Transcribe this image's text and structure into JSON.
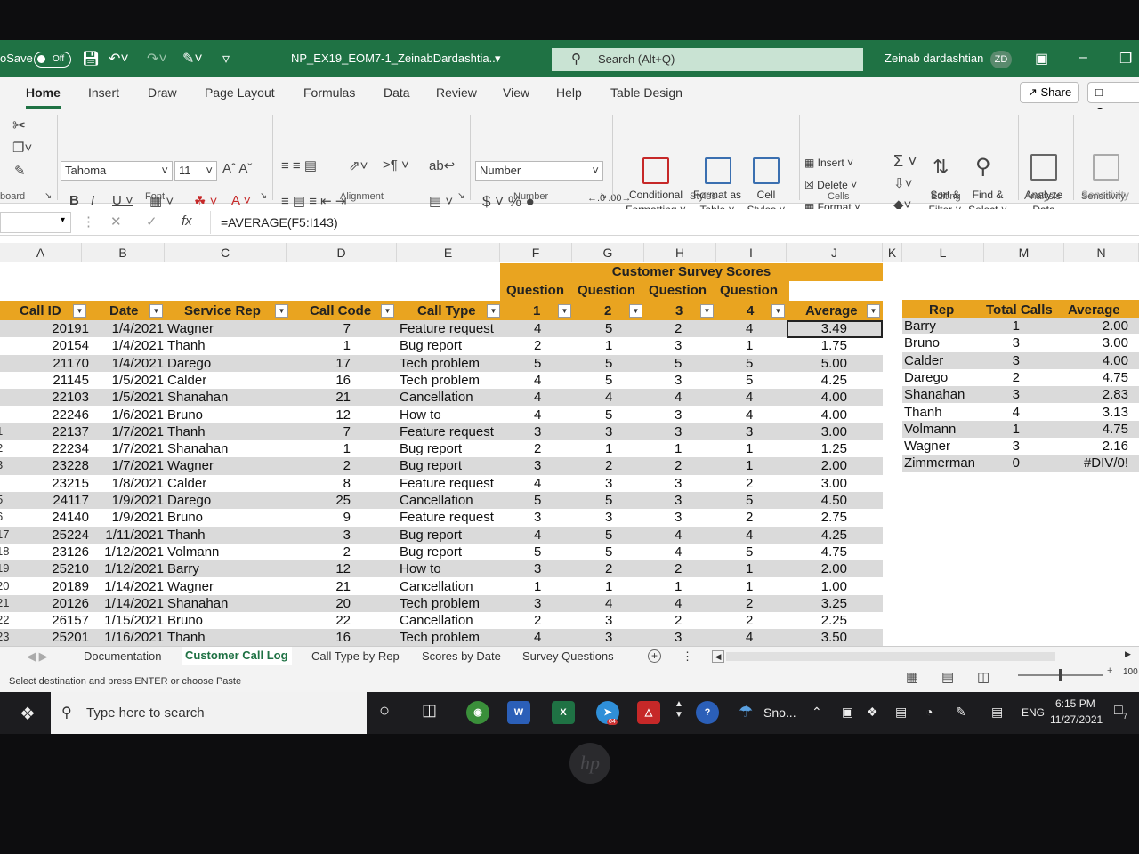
{
  "titlebar": {
    "autosave_label": "oSave",
    "autosave_state": "Off",
    "filename": "NP_EX19_EOM7-1_ZeinabDardashtia...",
    "search_placeholder": "Search (Alt+Q)",
    "user": "Zeinab dardashtian",
    "initials": "ZD"
  },
  "tabs": [
    "Home",
    "Insert",
    "Draw",
    "Page Layout",
    "Formulas",
    "Data",
    "Review",
    "View",
    "Help",
    "Table Design"
  ],
  "share_label": "Share",
  "comments_label": "Comm",
  "ribbon": {
    "font_name": "Tahoma",
    "font_size": "11",
    "number_format": "Number",
    "conditional_formatting": "Conditional",
    "formatting": "Formatting",
    "format_as": "Format as",
    "table": "Table",
    "cell": "Cell",
    "styles": "Styles",
    "insert": "Insert",
    "delete": "Delete",
    "format": "Format",
    "sort_filter_1": "Sort &",
    "sort_filter_2": "Filter",
    "find_select_1": "Find &",
    "find_select_2": "Select",
    "analyze_1": "Analyze",
    "analyze_2": "Data",
    "sensitivity": "Sensitivity",
    "groups": {
      "clipboard": "board",
      "font": "Font",
      "alignment": "Alignment",
      "number": "Number",
      "styles": "Styles",
      "cells": "Cells",
      "editing": "Editing",
      "analysis": "Analysis",
      "sensitivity": "Sensitivity"
    }
  },
  "formula_bar": {
    "fx": "fx",
    "formula": "=AVERAGE(F5:I143)"
  },
  "columns": [
    "A",
    "B",
    "C",
    "D",
    "E",
    "F",
    "G",
    "H",
    "I",
    "J",
    "K",
    "L",
    "M",
    "N"
  ],
  "banner": "Customer Survey Scores",
  "question_label": "Question",
  "headers": {
    "call_id": "Call ID",
    "date": "Date",
    "rep": "Service Rep",
    "code": "Call Code",
    "type": "Call Type",
    "q1": "1",
    "q2": "2",
    "q3": "3",
    "q4": "4",
    "avg": "Average"
  },
  "rows": [
    {
      "n": "",
      "id": "20191",
      "date": "1/4/2021",
      "rep": "Wagner",
      "code": "7",
      "type": "Feature request",
      "q1": "4",
      "q2": "5",
      "q3": "2",
      "q4": "4",
      "avg": "3.49"
    },
    {
      "n": "",
      "id": "20154",
      "date": "1/4/2021",
      "rep": "Thanh",
      "code": "1",
      "type": "Bug report",
      "q1": "2",
      "q2": "1",
      "q3": "3",
      "q4": "1",
      "avg": "1.75"
    },
    {
      "n": "",
      "id": "21170",
      "date": "1/4/2021",
      "rep": "Darego",
      "code": "17",
      "type": "Tech problem",
      "q1": "5",
      "q2": "5",
      "q3": "5",
      "q4": "5",
      "avg": "5.00"
    },
    {
      "n": "",
      "id": "21145",
      "date": "1/5/2021",
      "rep": "Calder",
      "code": "16",
      "type": "Tech problem",
      "q1": "4",
      "q2": "5",
      "q3": "3",
      "q4": "5",
      "avg": "4.25"
    },
    {
      "n": "",
      "id": "22103",
      "date": "1/5/2021",
      "rep": "Shanahan",
      "code": "21",
      "type": "Cancellation",
      "q1": "4",
      "q2": "4",
      "q3": "4",
      "q4": "4",
      "avg": "4.00"
    },
    {
      "n": "",
      "id": "22246",
      "date": "1/6/2021",
      "rep": "Bruno",
      "code": "12",
      "type": "How to",
      "q1": "4",
      "q2": "5",
      "q3": "3",
      "q4": "4",
      "avg": "4.00"
    },
    {
      "n": "1",
      "id": "22137",
      "date": "1/7/2021",
      "rep": "Thanh",
      "code": "7",
      "type": "Feature request",
      "q1": "3",
      "q2": "3",
      "q3": "3",
      "q4": "3",
      "avg": "3.00"
    },
    {
      "n": "2",
      "id": "22234",
      "date": "1/7/2021",
      "rep": "Shanahan",
      "code": "1",
      "type": "Bug report",
      "q1": "2",
      "q2": "1",
      "q3": "1",
      "q4": "1",
      "avg": "1.25"
    },
    {
      "n": "3",
      "id": "23228",
      "date": "1/7/2021",
      "rep": "Wagner",
      "code": "2",
      "type": "Bug report",
      "q1": "3",
      "q2": "2",
      "q3": "2",
      "q4": "1",
      "avg": "2.00"
    },
    {
      "n": "",
      "id": "23215",
      "date": "1/8/2021",
      "rep": "Calder",
      "code": "8",
      "type": "Feature request",
      "q1": "4",
      "q2": "3",
      "q3": "3",
      "q4": "2",
      "avg": "3.00"
    },
    {
      "n": "5",
      "id": "24117",
      "date": "1/9/2021",
      "rep": "Darego",
      "code": "25",
      "type": "Cancellation",
      "q1": "5",
      "q2": "5",
      "q3": "3",
      "q4": "5",
      "avg": "4.50"
    },
    {
      "n": "6",
      "id": "24140",
      "date": "1/9/2021",
      "rep": "Bruno",
      "code": "9",
      "type": "Feature request",
      "q1": "3",
      "q2": "3",
      "q3": "3",
      "q4": "2",
      "avg": "2.75"
    },
    {
      "n": "17",
      "id": "25224",
      "date": "1/11/2021",
      "rep": "Thanh",
      "code": "3",
      "type": "Bug report",
      "q1": "4",
      "q2": "5",
      "q3": "4",
      "q4": "4",
      "avg": "4.25"
    },
    {
      "n": "18",
      "id": "23126",
      "date": "1/12/2021",
      "rep": "Volmann",
      "code": "2",
      "type": "Bug report",
      "q1": "5",
      "q2": "5",
      "q3": "4",
      "q4": "5",
      "avg": "4.75"
    },
    {
      "n": "19",
      "id": "25210",
      "date": "1/12/2021",
      "rep": "Barry",
      "code": "12",
      "type": "How to",
      "q1": "3",
      "q2": "2",
      "q3": "2",
      "q4": "1",
      "avg": "2.00"
    },
    {
      "n": "20",
      "id": "20189",
      "date": "1/14/2021",
      "rep": "Wagner",
      "code": "21",
      "type": "Cancellation",
      "q1": "1",
      "q2": "1",
      "q3": "1",
      "q4": "1",
      "avg": "1.00"
    },
    {
      "n": "21",
      "id": "20126",
      "date": "1/14/2021",
      "rep": "Shanahan",
      "code": "20",
      "type": "Tech problem",
      "q1": "3",
      "q2": "4",
      "q3": "4",
      "q4": "2",
      "avg": "3.25"
    },
    {
      "n": "22",
      "id": "26157",
      "date": "1/15/2021",
      "rep": "Bruno",
      "code": "22",
      "type": "Cancellation",
      "q1": "2",
      "q2": "3",
      "q3": "2",
      "q4": "2",
      "avg": "2.25"
    },
    {
      "n": "23",
      "id": "25201",
      "date": "1/16/2021",
      "rep": "Thanh",
      "code": "16",
      "type": "Tech problem",
      "q1": "4",
      "q2": "3",
      "q3": "3",
      "q4": "4",
      "avg": "3.50"
    }
  ],
  "summary": {
    "headers": {
      "rep": "Rep",
      "total": "Total Calls",
      "avg": "Average Sc"
    },
    "rows": [
      {
        "rep": "Barry",
        "total": "1",
        "avg": "2.00"
      },
      {
        "rep": "Bruno",
        "total": "3",
        "avg": "3.00"
      },
      {
        "rep": "Calder",
        "total": "3",
        "avg": "4.00"
      },
      {
        "rep": "Darego",
        "total": "2",
        "avg": "4.75"
      },
      {
        "rep": "Shanahan",
        "total": "3",
        "avg": "2.83"
      },
      {
        "rep": "Thanh",
        "total": "4",
        "avg": "3.13"
      },
      {
        "rep": "Volmann",
        "total": "1",
        "avg": "4.75"
      },
      {
        "rep": "Wagner",
        "total": "3",
        "avg": "2.16"
      },
      {
        "rep": "Zimmerman",
        "total": "0",
        "avg": "#DIV/0!"
      }
    ]
  },
  "sheet_tabs": [
    "Documentation",
    "Customer Call Log",
    "Call Type by Rep",
    "Scores by Date",
    "Survey Questions"
  ],
  "status_text": "Select destination and press ENTER or choose Paste",
  "zoom": "100",
  "taskbar": {
    "search_placeholder": "Type here to search",
    "weather": "Sno...",
    "lang": "ENG",
    "time": "6:15 PM",
    "date": "11/27/2021",
    "notif_count": "7",
    "pdf_badge": "04"
  },
  "colors": {
    "excel_green": "#1f7244",
    "table_header": "#e9a420",
    "band": "#dadada"
  }
}
